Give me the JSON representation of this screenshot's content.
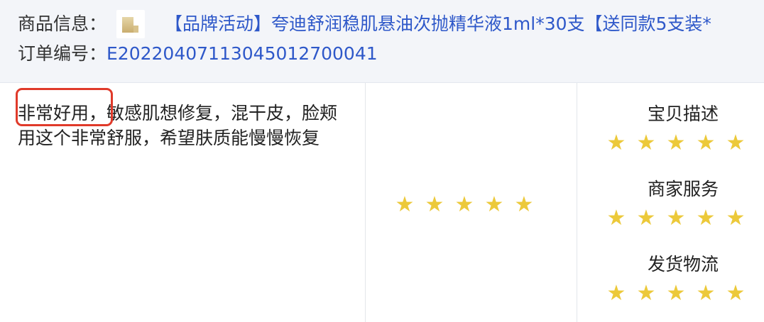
{
  "header": {
    "product_label": "商品信息：",
    "product_title": "【品牌活动】夸迪舒润稳肌悬油次抛精华液1ml*30支【送同款5支装*",
    "order_label": "订单编号：",
    "order_number": "E20220407113045012700041"
  },
  "review": {
    "text": "非常好用，敏感肌想修复，混干皮，脸颊用这个非常舒服，希望肤质能慢慢恢复",
    "highlighted_phrase": "非常好用，"
  },
  "overall_rating": {
    "stars": 5,
    "max": 5
  },
  "shop_ratings": [
    {
      "label": "宝贝描述",
      "stars": 5
    },
    {
      "label": "商家服务",
      "stars": 5
    },
    {
      "label": "发货物流",
      "stars": 5
    }
  ],
  "colors": {
    "link": "#2e58c9",
    "star": "#ecc93a",
    "highlight": "#e03a2a",
    "header_bg": "#f3f5f9"
  }
}
